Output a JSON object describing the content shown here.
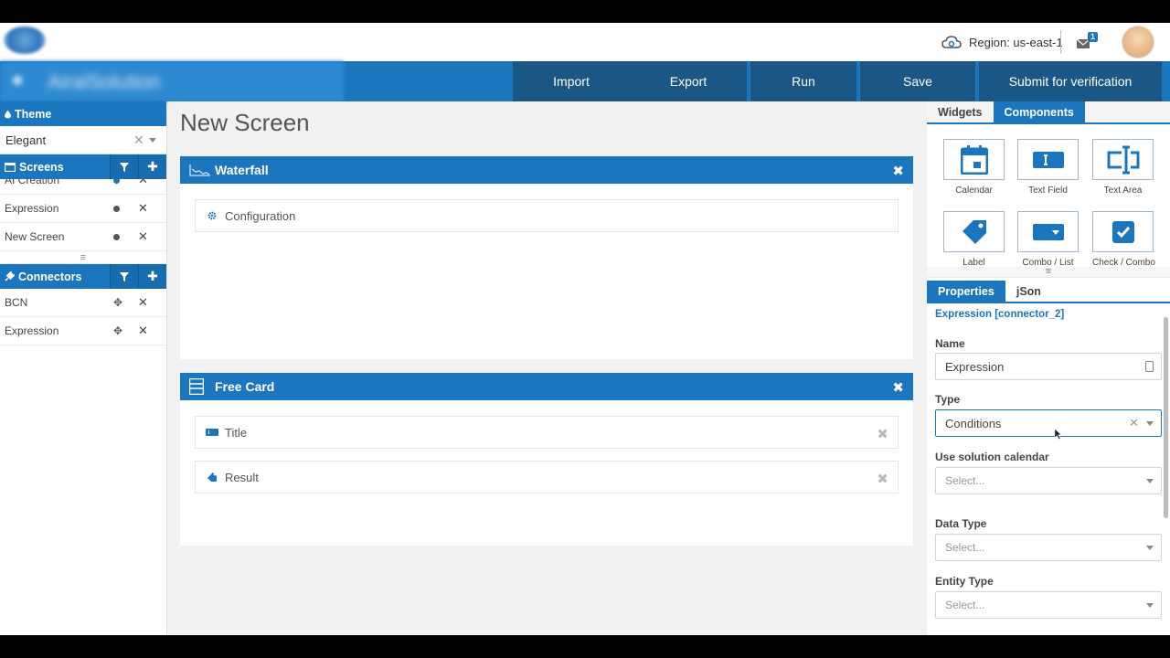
{
  "topbar": {
    "region_label": "Region: us-east-1",
    "mail_badge": "1"
  },
  "header": {
    "app_name": "AiralSolution",
    "buttons": [
      "Import",
      "Export",
      "Run",
      "Save",
      "Submit for verification"
    ]
  },
  "left": {
    "theme": {
      "title": "Theme",
      "value": "Elegant"
    },
    "screens": {
      "title": "Screens",
      "items": [
        {
          "label": "AI Creation",
          "status_color": "#1b76bd"
        },
        {
          "label": "Expression",
          "status_color": "#555555"
        },
        {
          "label": "New Screen",
          "status_color": "#555555"
        }
      ]
    },
    "connectors": {
      "title": "Connectors",
      "items": [
        {
          "label": "BCN"
        },
        {
          "label": "Expression"
        }
      ]
    }
  },
  "canvas": {
    "title": "New Screen",
    "cards": [
      {
        "title": "Waterfall",
        "icon": "chart-area-icon",
        "items": [
          {
            "label": "Configuration",
            "icon": "gear-icon"
          }
        ]
      },
      {
        "title": "Free Card",
        "icon": "list-icon",
        "items": [
          {
            "label": "Title",
            "icon": "textfield-icon"
          },
          {
            "label": "Result",
            "icon": "tag-icon"
          }
        ]
      }
    ]
  },
  "right": {
    "palette_tabs": [
      "Widgets",
      "Components"
    ],
    "active_palette_tab": "Components",
    "components": [
      {
        "label": "Calendar",
        "icon": "calendar-icon"
      },
      {
        "label": "Text Field",
        "icon": "textfield-icon"
      },
      {
        "label": "Text Area",
        "icon": "textarea-icon"
      },
      {
        "label": "Label",
        "icon": "tag-icon"
      },
      {
        "label": "Combo / List",
        "icon": "combo-icon"
      },
      {
        "label": "Check / Combo",
        "icon": "checkbox-icon"
      }
    ],
    "props_tabs": [
      "Properties",
      "jSon"
    ],
    "active_props_tab": "Properties",
    "selected_title": "Expression [connector_2]",
    "fields": {
      "name": {
        "label": "Name",
        "value": "Expression"
      },
      "type": {
        "label": "Type",
        "value": "Conditions"
      },
      "calendar": {
        "label": "Use solution calendar",
        "placeholder": "Select..."
      },
      "data_type": {
        "label": "Data Type",
        "placeholder": "Select..."
      },
      "entity_type": {
        "label": "Entity Type",
        "placeholder": "Select..."
      }
    }
  },
  "colors": {
    "primary": "#1b76bd",
    "dark_button": "#1a5784"
  }
}
